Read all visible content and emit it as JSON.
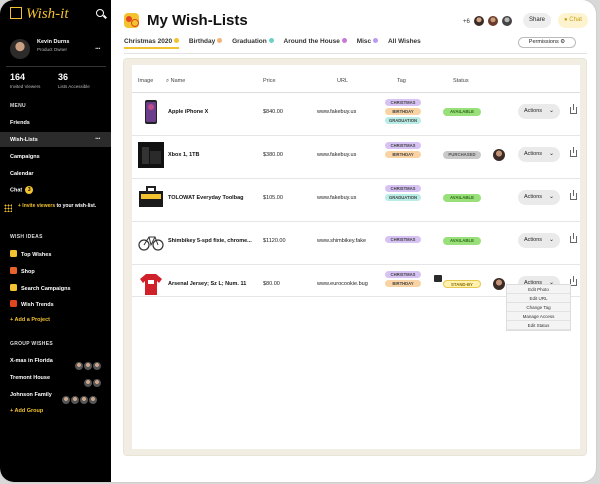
{
  "app": {
    "logo": "Wish-it",
    "title": "My Wish-Lists"
  },
  "user": {
    "name": "Kevin Durns",
    "role": "Product Owner"
  },
  "stats": [
    {
      "value": "164",
      "label": "Invited Viewers"
    },
    {
      "value": "36",
      "label": "Lists Accessible"
    }
  ],
  "sidebar": {
    "menu_heading": "MENU",
    "menu": [
      "Friends",
      "Wish-Lists",
      "Campaigns",
      "Calendar",
      "Chat"
    ],
    "chat_badge": "3",
    "invite_highlight": "+ Invite viewers",
    "invite_rest": " to your wish-list.",
    "wish_heading": "WISH IDEAS",
    "wish_ideas": [
      {
        "label": "Top Wishes",
        "color": "#f2c230"
      },
      {
        "label": "Shop",
        "color": "#e8622c"
      },
      {
        "label": "Search Campaigns",
        "color": "#f2c230"
      },
      {
        "label": "Wish Trends",
        "color": "#e2461f"
      }
    ],
    "add_project": "+ Add a Project",
    "group_heading": "GROUP WISHES",
    "groups": [
      "X-mas in Florida",
      "Tremont House",
      "Johnson Family"
    ],
    "add_group": "+ Add Group"
  },
  "header": {
    "viewers_more": "+6",
    "share": "Share",
    "chat": "Chat"
  },
  "tabs": [
    {
      "label": "Christmas 2020",
      "dot": "#f2c230"
    },
    {
      "label": "Birthday",
      "dot": "#f2b27a"
    },
    {
      "label": "Graduation",
      "dot": "#6ad3c6"
    },
    {
      "label": "Around the House",
      "dot": "#c77ad8"
    },
    {
      "label": "Misc",
      "dot": "#bb9af0"
    },
    {
      "label": "All Wishes",
      "dot": ""
    }
  ],
  "permissions": "Permissions",
  "table": {
    "headers": [
      "Image",
      "Name",
      "Price",
      "URL",
      "Tag",
      "Status"
    ],
    "rows": [
      {
        "name": "Apple iPhone X",
        "price": "$840.00",
        "url": "www.fakebuy.us",
        "tags": [
          "CHRISTMAS",
          "BIRTHDAY",
          "GRADUATION"
        ],
        "status": "AVAILABLE",
        "action": "Actions"
      },
      {
        "name": "Xbox 1, 1TB",
        "price": "$380.00",
        "url": "www.fakebuy.us",
        "tags": [
          "CHRISTMAS",
          "BIRTHDAY"
        ],
        "status": "PURCHASED",
        "action": "Actions"
      },
      {
        "name": "TOLOWAT Everyday Toolbag",
        "price": "$105.00",
        "url": "www.fakebuy.us",
        "tags": [
          "CHRISTMAS",
          "GRADUATION"
        ],
        "status": "AVAILABLE",
        "action": "Actions"
      },
      {
        "name": "Shimbikey 5-spd fixie, chrome...",
        "price": "$1120.00",
        "url": "www.shimbikey.fake",
        "tags": [
          "CHRISTMAS"
        ],
        "status": "AVAILABLE",
        "action": "Actions"
      },
      {
        "name": "Arsenal Jersey; Sz L; Num. 11",
        "price": "$80.00",
        "url": "www.eurocookie.bug",
        "tags": [
          "CHRISTMAS",
          "BIRTHDAY"
        ],
        "status": "STAND-BY",
        "action": "Actions"
      }
    ]
  },
  "action_menu": [
    "Edit Photo",
    "Edit URL",
    "Change Tag",
    "Manage Access",
    "Edit Status"
  ],
  "colors": {
    "accent": "#f2c230",
    "tag_christmas": "#d7c2f4",
    "tag_birthday": "#f9d3a3",
    "tag_graduation": "#b9ece5",
    "status_available": "#9ae07a",
    "status_purchased": "#c9c9c9",
    "status_standby": "#fff2b0"
  }
}
